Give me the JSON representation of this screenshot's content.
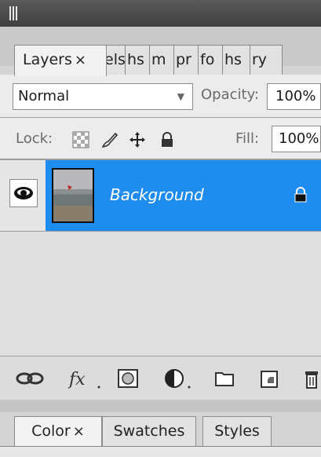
{
  "tabs": [
    {
      "label": "Layers",
      "close": "×",
      "active": true
    },
    {
      "label": "els"
    },
    {
      "label": "hs"
    },
    {
      "label": "m"
    },
    {
      "label": "pr"
    },
    {
      "label": "fo"
    },
    {
      "label": "hs"
    },
    {
      "label": "ry"
    }
  ],
  "blend": {
    "value": "Normal"
  },
  "opacity": {
    "label": "Opacity:",
    "value": "100%"
  },
  "lock": {
    "label": "Lock:"
  },
  "fill": {
    "label": "Fill:",
    "value": "100%"
  },
  "layer": {
    "name": "Background"
  },
  "lower_tabs": [
    {
      "label": "Color",
      "close": "×",
      "active": true
    },
    {
      "label": "Swatches"
    },
    {
      "label": "Styles"
    }
  ]
}
